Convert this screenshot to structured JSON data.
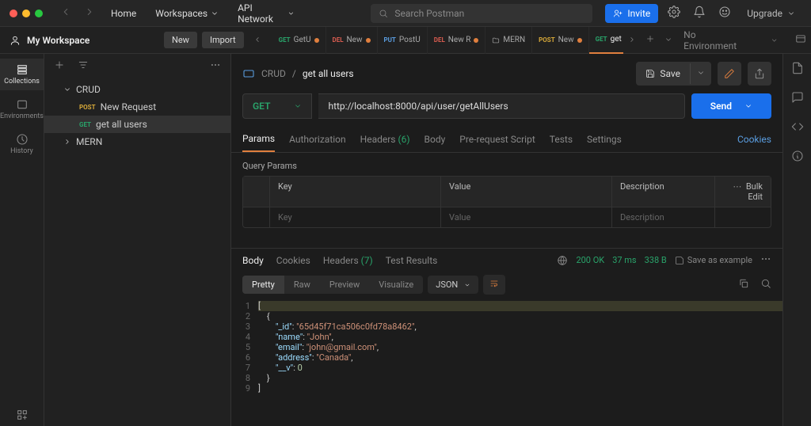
{
  "nav": {
    "home": "Home",
    "workspaces": "Workspaces",
    "api_network": "API Network",
    "search_placeholder": "Search Postman",
    "invite": "Invite",
    "upgrade": "Upgrade"
  },
  "workspace": {
    "name": "My Workspace",
    "new_btn": "New",
    "import_btn": "Import",
    "environment": "No Environment"
  },
  "tabs": [
    {
      "method": "GET",
      "label": "GetU",
      "unsaved": true
    },
    {
      "method": "DEL",
      "label": "New",
      "unsaved": true
    },
    {
      "method": "PUT",
      "label": "PostU",
      "unsaved": false
    },
    {
      "method": "DEL",
      "label": "New R",
      "unsaved": true
    },
    {
      "method": "",
      "label": "MERN",
      "unsaved": false,
      "folder": true
    },
    {
      "method": "POST",
      "label": "New",
      "unsaved": true
    },
    {
      "method": "GET",
      "label": "get a",
      "unsaved": true,
      "active": true
    }
  ],
  "iconcol": {
    "collections": "Collections",
    "environments": "Environments",
    "history": "History"
  },
  "tree": {
    "crud": "CRUD",
    "new_request": "New Request",
    "get_all_users": "get all users",
    "mern": "MERN"
  },
  "breadcrumb": {
    "parent": "CRUD",
    "current": "get all users",
    "save": "Save"
  },
  "request": {
    "method": "GET",
    "url": "http://localhost:8000/api/user/getAllUsers",
    "send": "Send"
  },
  "req_tabs": {
    "params": "Params",
    "auth": "Authorization",
    "headers": "Headers",
    "headers_count": "(6)",
    "body": "Body",
    "prereq": "Pre-request Script",
    "tests": "Tests",
    "settings": "Settings",
    "cookies": "Cookies"
  },
  "qp": {
    "title": "Query Params",
    "key": "Key",
    "value": "Value",
    "description": "Description",
    "bulk": "Bulk Edit",
    "ph_key": "Key",
    "ph_value": "Value",
    "ph_desc": "Description"
  },
  "resp_tabs": {
    "body": "Body",
    "cookies": "Cookies",
    "headers": "Headers",
    "headers_count": "(7)",
    "tests": "Test Results"
  },
  "resp_meta": {
    "status": "200 OK",
    "time": "37 ms",
    "size": "338 B",
    "save_example": "Save as example"
  },
  "view": {
    "pretty": "Pretty",
    "raw": "Raw",
    "preview": "Preview",
    "visualize": "Visualize",
    "format": "JSON"
  },
  "response_body": [
    {
      "n": "1",
      "t": "[",
      "hl": true
    },
    {
      "n": "2",
      "t": "    {"
    },
    {
      "n": "3",
      "t": "        \"_id\": \"65d45f71ca506c0fd78a8462\","
    },
    {
      "n": "4",
      "t": "        \"name\": \"John\","
    },
    {
      "n": "5",
      "t": "        \"email\": \"john@gmail.com\","
    },
    {
      "n": "6",
      "t": "        \"address\": \"Canada\","
    },
    {
      "n": "7",
      "t": "        \"__v\": 0"
    },
    {
      "n": "8",
      "t": "    }"
    },
    {
      "n": "9",
      "t": "]"
    }
  ]
}
